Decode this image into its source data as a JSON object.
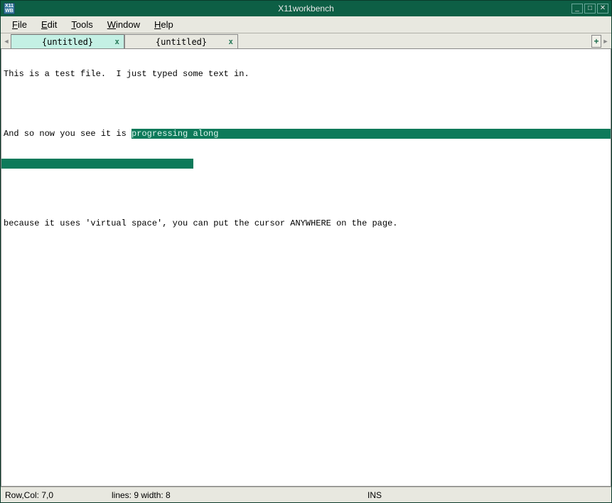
{
  "window": {
    "title": "X11workbench"
  },
  "menu": {
    "file": "File",
    "edit": "Edit",
    "tools": "Tools",
    "window": "Window",
    "help": "Help"
  },
  "tabs": [
    {
      "label": "{untitled}",
      "active": true
    },
    {
      "label": "{untitled}",
      "active": false
    }
  ],
  "editor": {
    "line1": "This is a test file.  I just typed some text in.",
    "line3_pre": "And so now you see it is ",
    "line3_sel": "progressing along",
    "line6": "because it uses 'virtual space', you can put the cursor ANYWHERE on the page."
  },
  "status": {
    "rowcol": "Row,Col: 7,0",
    "lines_width": "lines:  9  width:  8",
    "mode": "INS"
  }
}
